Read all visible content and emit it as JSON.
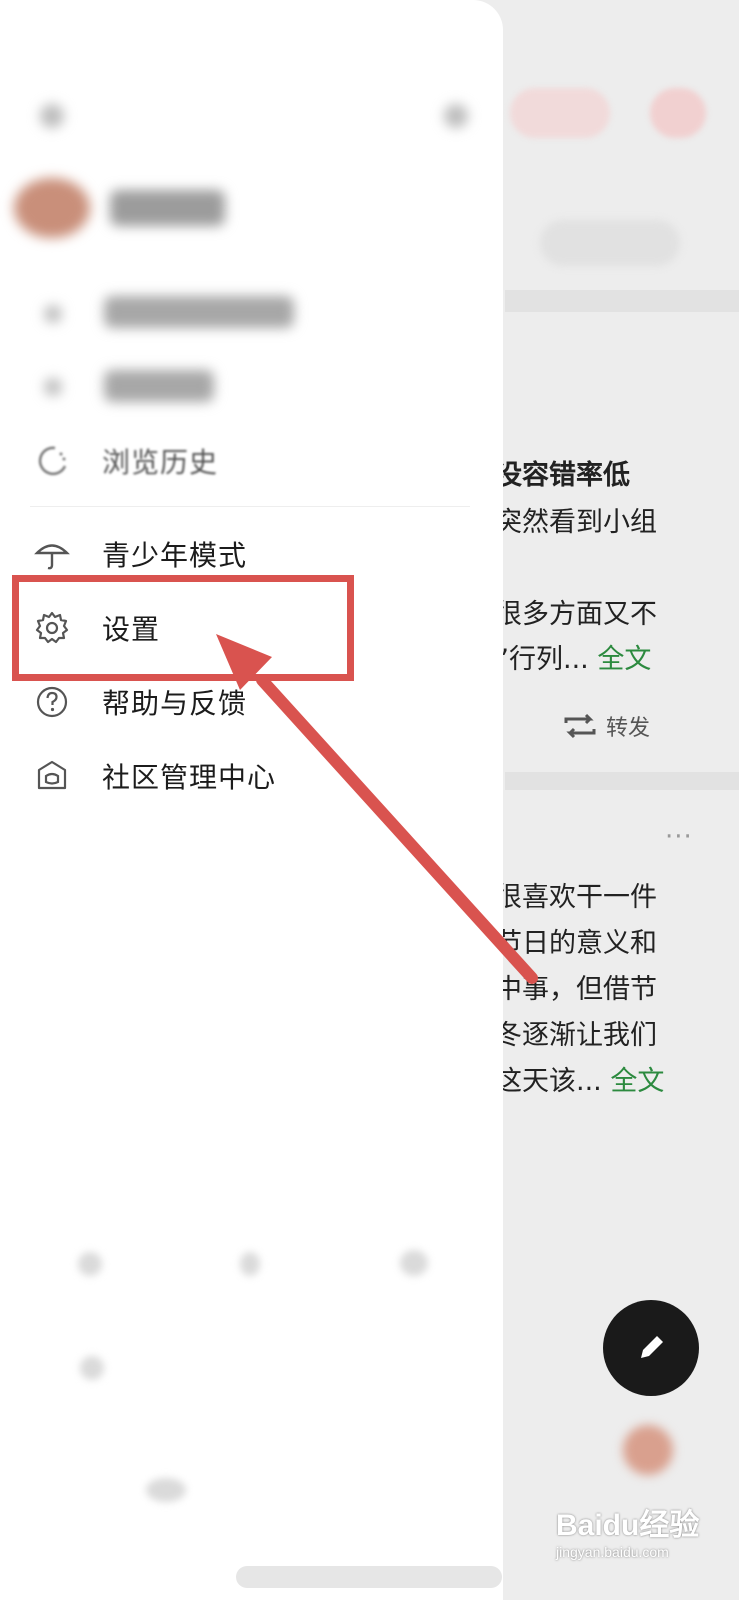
{
  "background_feed": {
    "card1_lines": [
      "没容错率低",
      "突然看到小组",
      "很多方面又不",
      "”行列..."
    ],
    "card1_more": "全文",
    "repost_label": "转发",
    "card2_lines": [
      "很喜欢干一件",
      "节日的意义和",
      "中事，但借节",
      "冬逐渐让我们",
      "这天该..."
    ],
    "card2_more": "全文",
    "more_dots": "···",
    "fab_icon": "pencil-icon"
  },
  "drawer": {
    "menu": [
      {
        "label": "浏览历史",
        "icon": "history-icon"
      },
      {
        "label": "青少年模式",
        "icon": "umbrella-icon"
      },
      {
        "label": "设置",
        "icon": "gear-icon"
      },
      {
        "label": "帮助与反馈",
        "icon": "help-circle-icon"
      },
      {
        "label": "社区管理中心",
        "icon": "shield-home-icon"
      }
    ]
  },
  "watermark": {
    "brand": "Baidu",
    "brand_cn": "经验",
    "url": "jingyan.baidu.com"
  },
  "colors": {
    "accent_green": "#2c8a3f",
    "annotation_red": "#d9534f"
  }
}
